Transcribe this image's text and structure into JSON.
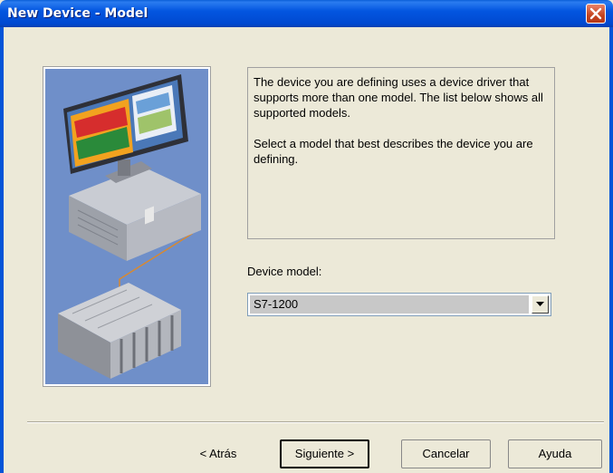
{
  "window": {
    "title": "New Device - Model"
  },
  "description": {
    "para1": "The device you are defining uses a device driver that supports more than one model.  The list below shows all supported models.",
    "para2": "Select  a model that best describes the device you are defining."
  },
  "model": {
    "label": "Device model:",
    "selected": "S7-1200"
  },
  "buttons": {
    "back": "< Atrás",
    "next": "Siguiente >",
    "cancel": "Cancelar",
    "help": "Ayuda"
  },
  "colors": {
    "titlebar": "#0356e0",
    "illustration_bg": "#6f8fc9",
    "dialog_bg": "#ece9d8"
  }
}
